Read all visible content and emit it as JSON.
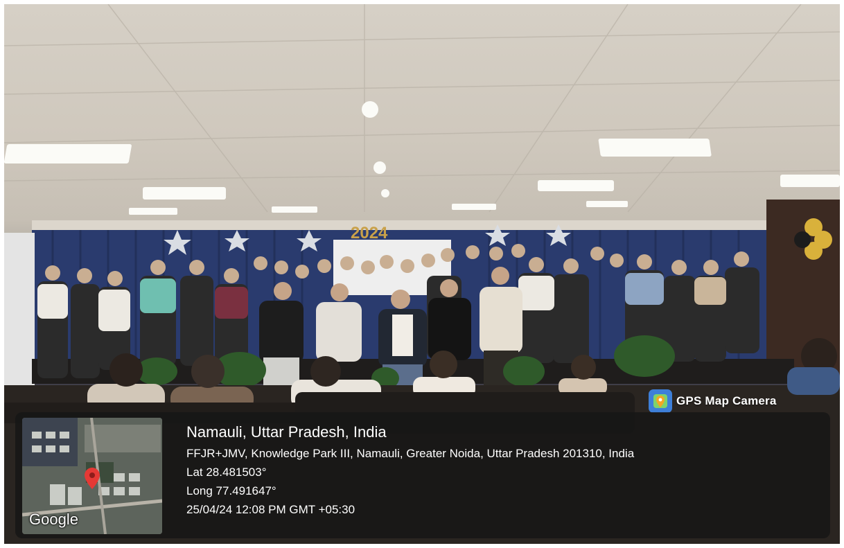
{
  "photo": {
    "banner_text": "2024"
  },
  "gps_badge": {
    "label": "GPS Map Camera",
    "icon": "map-pin-icon"
  },
  "location": {
    "place": "Namauli, Uttar Pradesh, India",
    "address": "FFJR+JMV, Knowledge Park III, Namauli, Greater Noida, Uttar Pradesh 201310, India",
    "lat": "Lat 28.481503°",
    "long": "Long 77.491647°",
    "datetime": "25/04/24 12:08 PM GMT +05:30"
  },
  "map": {
    "brand": "Google",
    "pin_color": "#e53935"
  },
  "colors": {
    "overlay": "#161616",
    "curtain": "#2a3b6e",
    "badge_blue": "#3e7fd8"
  }
}
